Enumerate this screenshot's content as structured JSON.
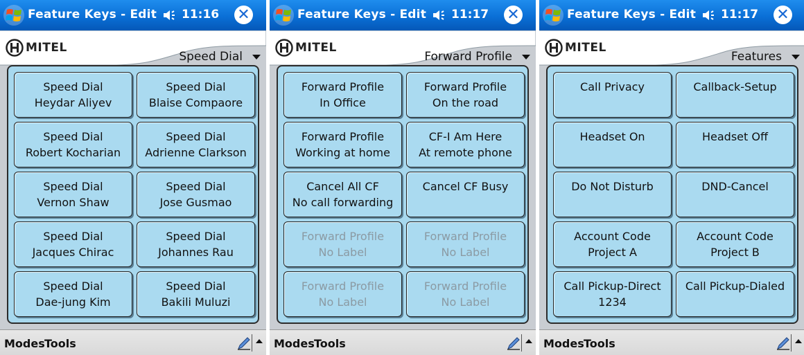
{
  "screens": [
    {
      "title": "Feature Keys - Edit",
      "time": "11:16",
      "logo": "MITEL",
      "category": "Speed Dial",
      "menu": {
        "modes": "Modes",
        "tools": "Tools"
      },
      "keys": [
        {
          "line1": "Speed Dial",
          "line2": "Heydar Aliyev",
          "disabled": false
        },
        {
          "line1": "Speed Dial",
          "line2": "Blaise Compaore",
          "disabled": false
        },
        {
          "line1": "Speed Dial",
          "line2": "Robert Kocharian",
          "disabled": false
        },
        {
          "line1": "Speed Dial",
          "line2": "Adrienne Clarkson",
          "disabled": false
        },
        {
          "line1": "Speed Dial",
          "line2": "Vernon Shaw",
          "disabled": false
        },
        {
          "line1": "Speed Dial",
          "line2": "Jose Gusmao",
          "disabled": false
        },
        {
          "line1": "Speed Dial",
          "line2": "Jacques Chirac",
          "disabled": false
        },
        {
          "line1": "Speed Dial",
          "line2": "Johannes Rau",
          "disabled": false
        },
        {
          "line1": "Speed Dial",
          "line2": "Dae-jung Kim",
          "disabled": false
        },
        {
          "line1": "Speed Dial",
          "line2": "Bakili Muluzi",
          "disabled": false
        }
      ]
    },
    {
      "title": "Feature Keys - Edit",
      "time": "11:17",
      "logo": "MITEL",
      "category": "Forward Profile",
      "menu": {
        "modes": "Modes",
        "tools": "Tools"
      },
      "keys": [
        {
          "line1": "Forward Profile",
          "line2": "In Office",
          "disabled": false
        },
        {
          "line1": "Forward Profile",
          "line2": "On the road",
          "disabled": false
        },
        {
          "line1": "Forward Profile",
          "line2": "Working at home",
          "disabled": false
        },
        {
          "line1": "CF-I Am Here",
          "line2": "At remote phone",
          "disabled": false
        },
        {
          "line1": "Cancel All CF",
          "line2": "No call forwarding",
          "disabled": false
        },
        {
          "line1": "Cancel CF Busy",
          "line2": "",
          "disabled": false
        },
        {
          "line1": "Forward Profile",
          "line2": "No Label",
          "disabled": true
        },
        {
          "line1": "Forward Profile",
          "line2": "No Label",
          "disabled": true
        },
        {
          "line1": "Forward Profile",
          "line2": "No Label",
          "disabled": true
        },
        {
          "line1": "Forward Profile",
          "line2": "No Label",
          "disabled": true
        }
      ]
    },
    {
      "title": "Feature Keys - Edit",
      "time": "11:17",
      "logo": "MITEL",
      "category": "Features",
      "menu": {
        "modes": "Modes",
        "tools": "Tools"
      },
      "keys": [
        {
          "line1": "Call Privacy",
          "line2": "",
          "disabled": false
        },
        {
          "line1": "Callback-Setup",
          "line2": "",
          "disabled": false
        },
        {
          "line1": "Headset On",
          "line2": "",
          "disabled": false
        },
        {
          "line1": "Headset Off",
          "line2": "",
          "disabled": false
        },
        {
          "line1": "Do Not Disturb",
          "line2": "",
          "disabled": false
        },
        {
          "line1": "DND-Cancel",
          "line2": "",
          "disabled": false
        },
        {
          "line1": "Account Code",
          "line2": "Project A",
          "disabled": false
        },
        {
          "line1": "Account Code",
          "line2": "Project B",
          "disabled": false
        },
        {
          "line1": "Call Pickup-Direct",
          "line2": "1234",
          "disabled": false
        },
        {
          "line1": "Call Pickup-Dialed",
          "line2": "",
          "disabled": false
        }
      ]
    }
  ],
  "icons": {
    "start": "windows-flag-icon",
    "speaker": "speaker-icon",
    "close": "close-icon",
    "pen": "pen-icon",
    "sip": "sip-arrow-icon"
  },
  "colors": {
    "titlebar": "#0a6fd6",
    "panel": "#a7d8ee",
    "key": "#aadaf0",
    "disabled_text": "#8b9aa3"
  }
}
